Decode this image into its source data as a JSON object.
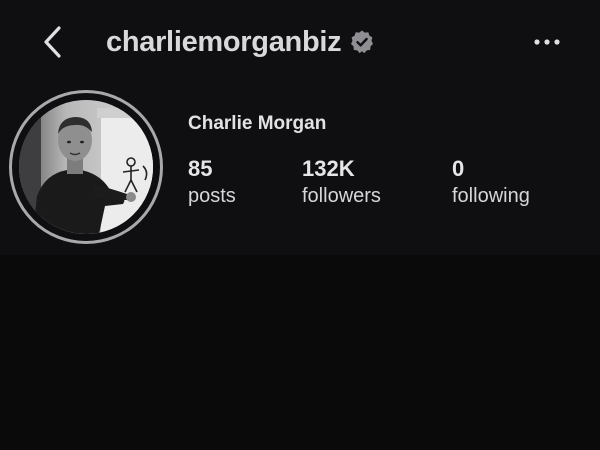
{
  "header": {
    "username": "charliemorganbiz",
    "back_icon": "chevron-left-icon",
    "verified_icon": "verified-badge-icon",
    "more_icon": "more-horizontal-icon"
  },
  "profile": {
    "display_name": "Charlie Morgan",
    "avatar_icon": "profile-photo",
    "stats": [
      {
        "value": "85",
        "label": "posts"
      },
      {
        "value": "132K",
        "label": "followers"
      },
      {
        "value": "0",
        "label": "following"
      }
    ]
  },
  "colors": {
    "background": "#0a0a0b",
    "header_background": "#0f0f11",
    "text": "#e6e6e8",
    "verified_badge": "#8e8e93",
    "avatar_ring": "#a9a9ad"
  }
}
